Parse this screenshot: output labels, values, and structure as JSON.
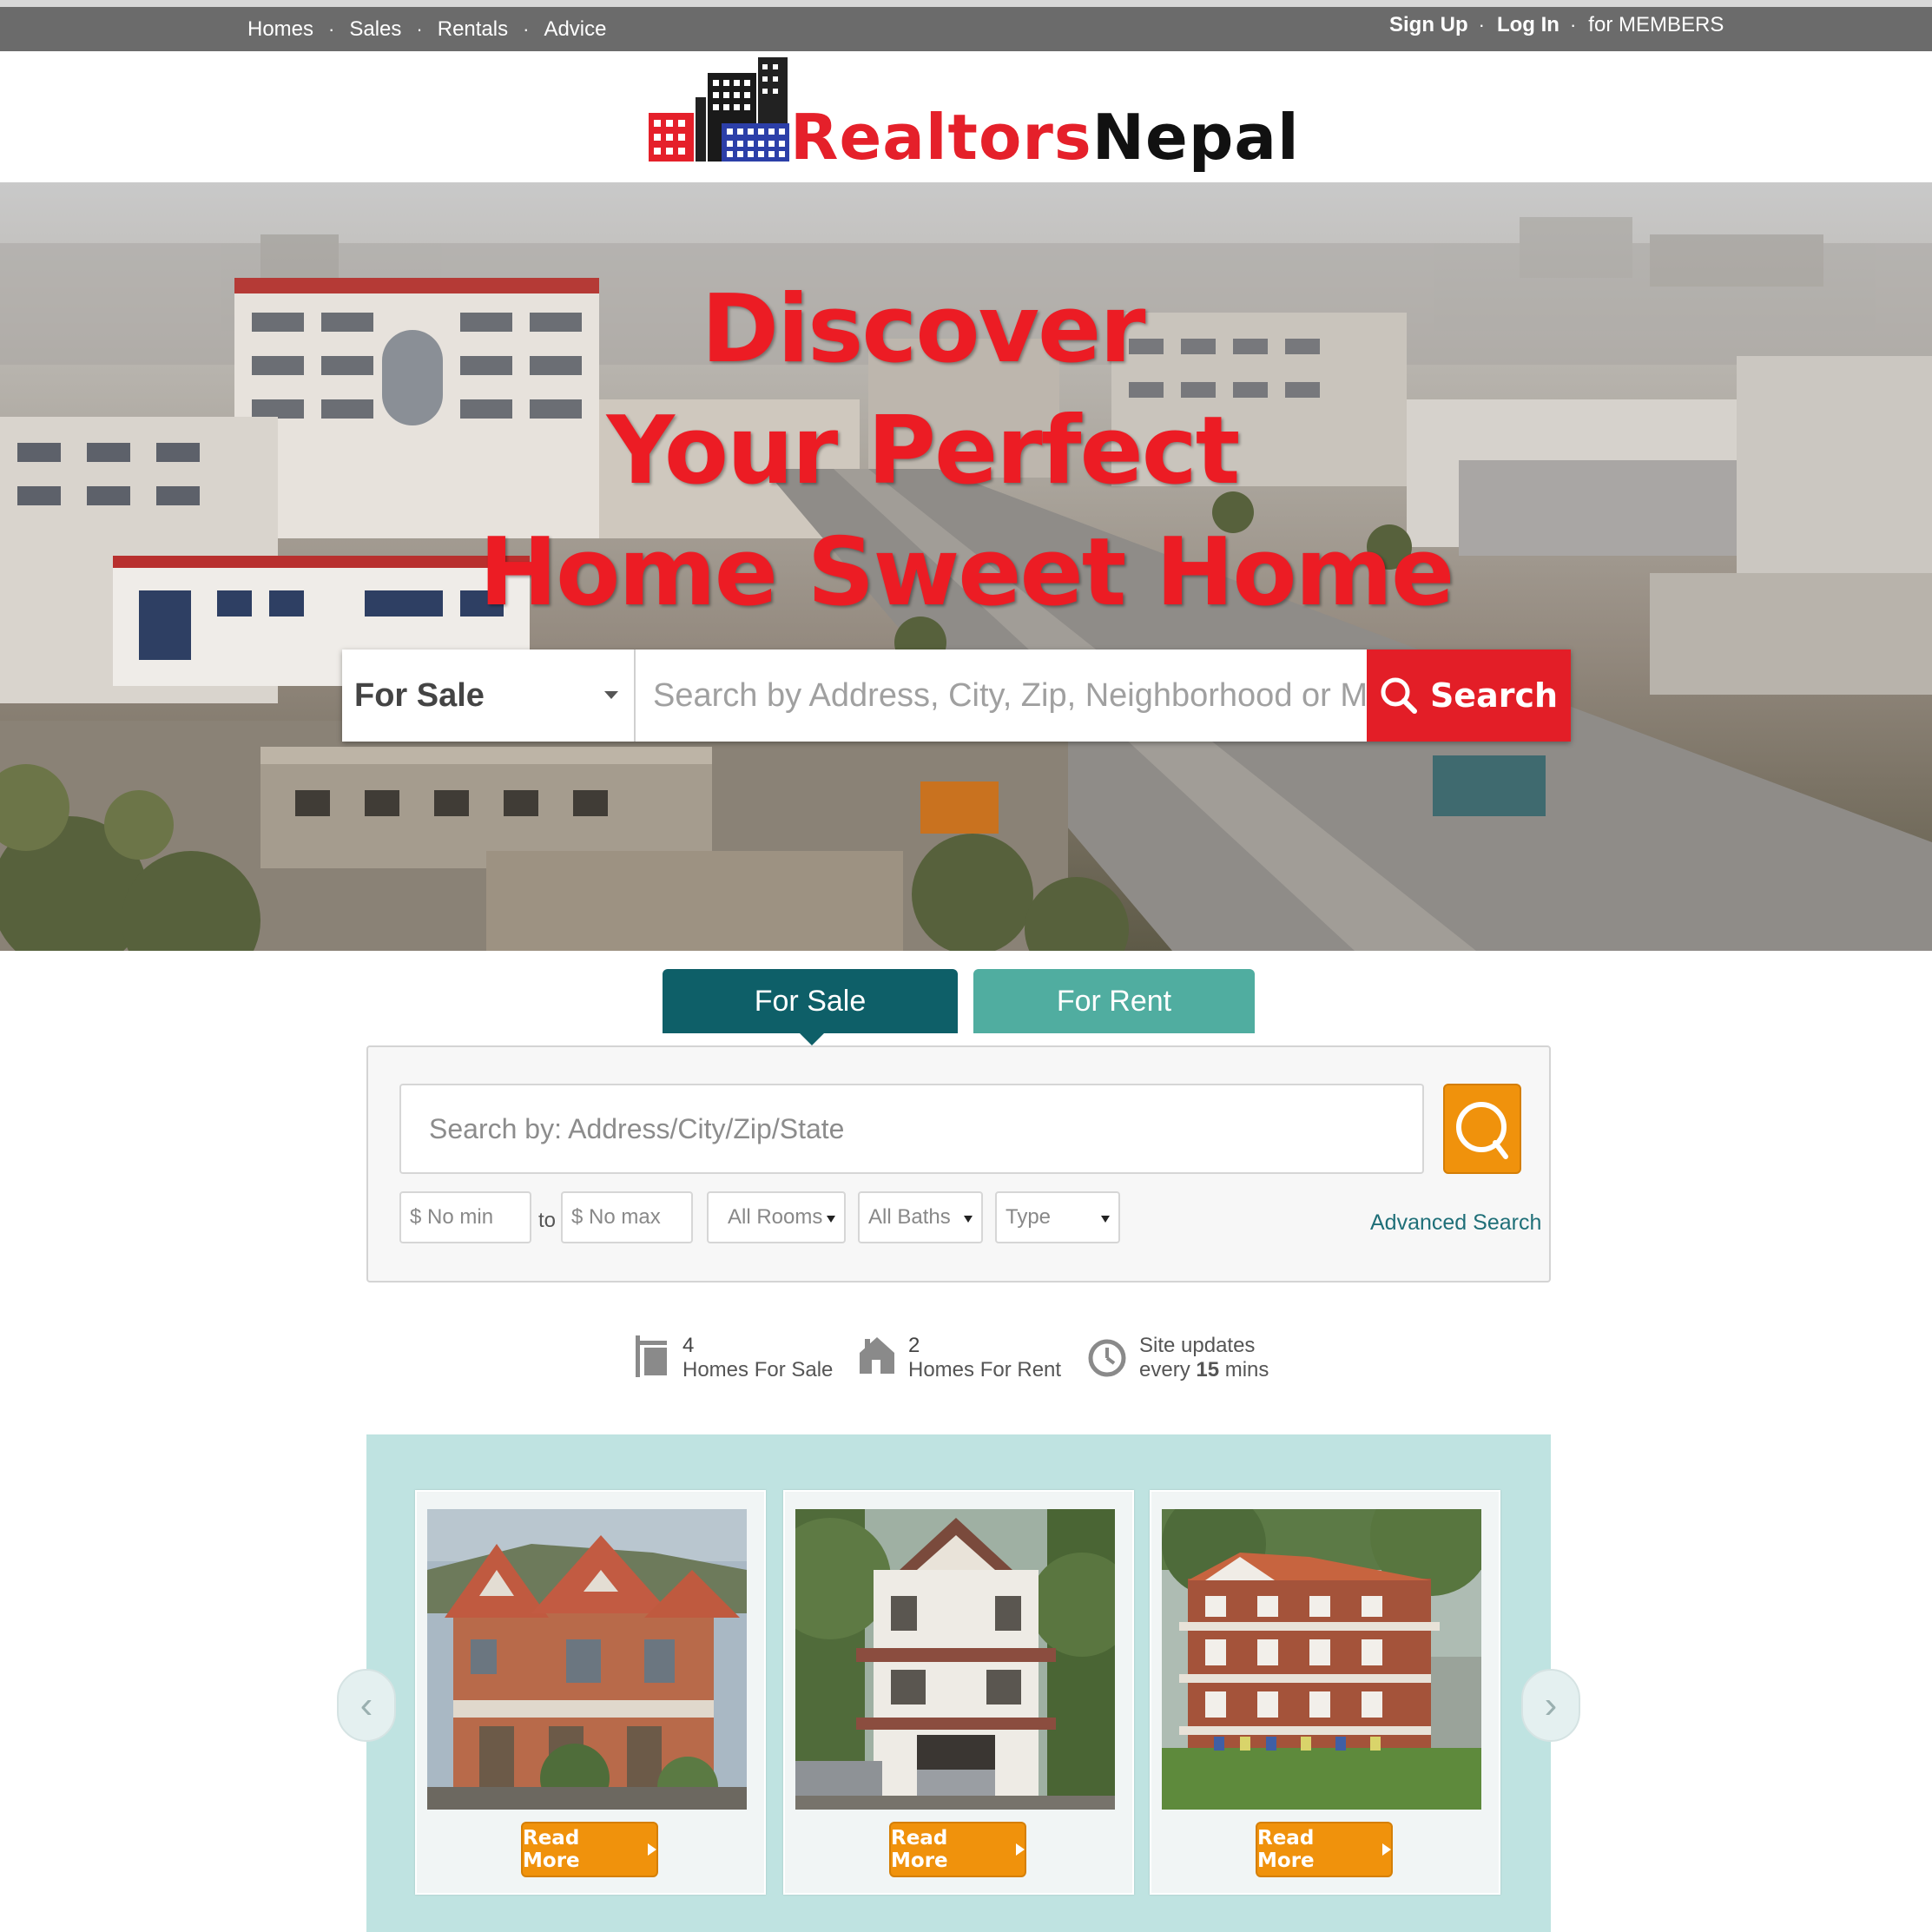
{
  "nav": {
    "links": [
      "Homes",
      "Sales",
      "Rentals",
      "Advice"
    ],
    "account": {
      "signup": "Sign Up",
      "login": "Log In",
      "members": "for MEMBERS"
    },
    "separator": "·"
  },
  "logo": {
    "part1": "Realtors",
    "part2": "Nepal"
  },
  "hero": {
    "headline": [
      "Discover",
      "Your Perfect",
      "Home Sweet Home"
    ],
    "search": {
      "select_value": "For Sale",
      "placeholder": "Search by Address, City, Zip, Neighborhood or MLS",
      "button_label": "Search"
    }
  },
  "tabs": {
    "sale": "For Sale",
    "rent": "For Rent",
    "active": "sale"
  },
  "filter": {
    "placeholder": "Search by: Address/City/Zip/State",
    "min_placeholder": "$ No min",
    "to_label": "to",
    "max_placeholder": "$ No max",
    "rooms": "All Rooms",
    "baths": "All Baths",
    "type": "Type",
    "advanced": "Advanced Search"
  },
  "stats": {
    "for_sale": {
      "count": "4",
      "label": "Homes For Sale"
    },
    "for_rent": {
      "count": "2",
      "label": "Homes For Rent"
    },
    "updates": {
      "line1": "Site updates",
      "prefix": "every",
      "minutes": "15",
      "suffix": "mins"
    }
  },
  "listings": {
    "read_more": "Read More",
    "cards": 3
  },
  "colors": {
    "brand_red": "#e5202a",
    "teal_dark": "#0e5f68",
    "teal_light": "#50ada0",
    "orange": "#f0920c",
    "listings_bg": "#bfe3e1",
    "nav_bg": "#6b6b6b"
  },
  "icons": {
    "search_button": "search-icon",
    "filter_search": "magnifier-icon",
    "stat_sale": "for-sale-sign-icon",
    "stat_rent": "house-icon",
    "stat_updates": "clock-icon",
    "carousel_prev": "chevron-left-icon",
    "carousel_next": "chevron-right-icon"
  }
}
